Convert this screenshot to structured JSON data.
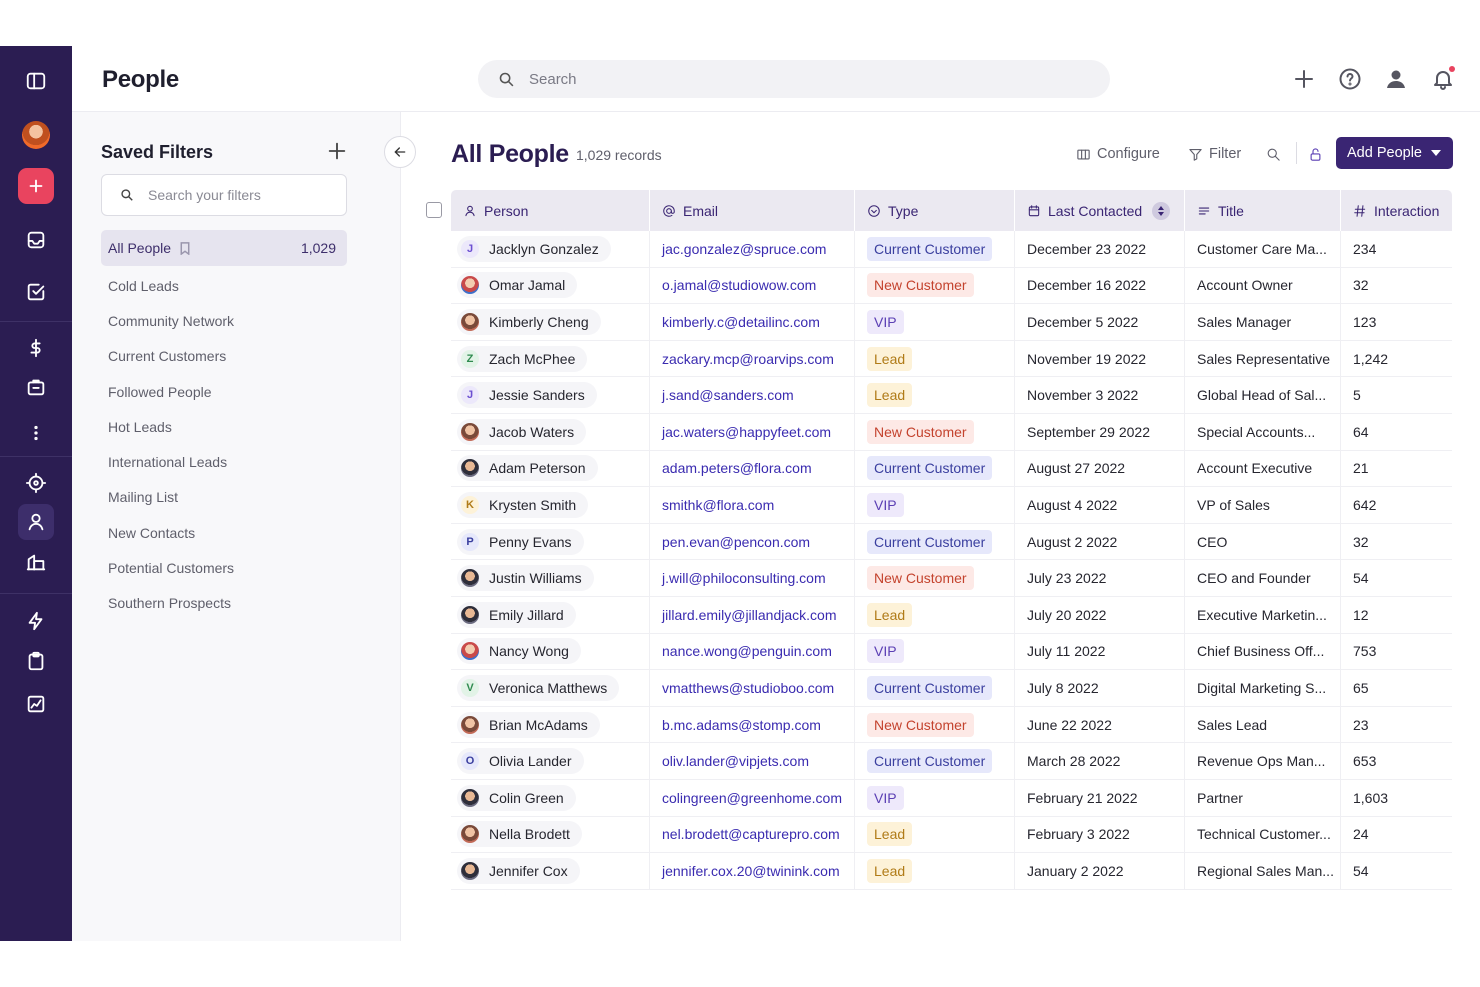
{
  "header": {
    "page_title": "People",
    "search_placeholder": "Search"
  },
  "rail": {
    "icons": [
      "sidebar-toggle-icon",
      "avatar",
      "add-icon",
      "inbox-icon",
      "tasks-icon",
      "dollar-icon",
      "briefcase-icon",
      "more-icon",
      "target-icon",
      "person-icon",
      "building-icon",
      "lightning-icon",
      "clipboard-icon",
      "chart-icon"
    ],
    "accent": "#e9445f",
    "bg": "#2b1d52"
  },
  "filters": {
    "title": "Saved Filters",
    "search_placeholder": "Search your filters",
    "items": [
      {
        "label": "All People",
        "count": "1,029"
      },
      {
        "label": "Cold Leads"
      },
      {
        "label": "Community Network"
      },
      {
        "label": "Current Customers"
      },
      {
        "label": "Followed People"
      },
      {
        "label": "Hot Leads"
      },
      {
        "label": "International Leads"
      },
      {
        "label": "Mailing List"
      },
      {
        "label": "New Contacts"
      },
      {
        "label": "Potential Customers"
      },
      {
        "label": "Southern Prospects"
      }
    ]
  },
  "main": {
    "title": "All People",
    "record_count": "1,029 records",
    "toolbar": {
      "configure": "Configure",
      "filter": "Filter",
      "add_people": "Add People"
    },
    "columns": [
      "Person",
      "Email",
      "Type",
      "Last Contacted",
      "Title",
      "Interaction"
    ],
    "rows": [
      {
        "initial": "J",
        "avatar_color": "#6b4fd1",
        "avatar_bg": "#ece8fb",
        "name": "Jacklyn Gonzalez",
        "email": "jac.gonzalez@spruce.com",
        "type": "Current Customer",
        "date": "December 23 2022",
        "title": "Customer Care Ma...",
        "interaction": "234"
      },
      {
        "initial": "",
        "avatar_style": "photo3",
        "name": "Omar Jamal",
        "email": "o.jamal@studiowow.com",
        "type": "New Customer",
        "date": "December 16 2022",
        "title": "Account Owner",
        "interaction": "32"
      },
      {
        "initial": "",
        "avatar_style": "photo",
        "name": "Kimberly Cheng",
        "email": "kimberly.c@detailinc.com",
        "type": "VIP",
        "date": "December 5 2022",
        "title": "Sales Manager",
        "interaction": "123"
      },
      {
        "initial": "Z",
        "avatar_color": "#2f8a4f",
        "avatar_bg": "#e2f3e7",
        "name": "Zach McPhee",
        "email": "zackary.mcp@roarvips.com",
        "type": "Lead",
        "date": "November 19 2022",
        "title": "Sales Representative",
        "interaction": "1,242"
      },
      {
        "initial": "J",
        "avatar_color": "#6b4fd1",
        "avatar_bg": "#ece8fb",
        "name": "Jessie Sanders",
        "email": "j.sand@sanders.com",
        "type": "Lead",
        "date": "November 3 2022",
        "title": "Global Head of Sal...",
        "interaction": "5"
      },
      {
        "initial": "",
        "avatar_style": "photo",
        "name": "Jacob Waters",
        "email": "jac.waters@happyfeet.com",
        "type": "New Customer",
        "date": "September 29 2022",
        "title": "Special Accounts...",
        "interaction": "64"
      },
      {
        "initial": "",
        "avatar_style": "photo2",
        "name": "Adam Peterson",
        "email": "adam.peters@flora.com",
        "type": "Current Customer",
        "date": "August 27 2022",
        "title": "Account Executive",
        "interaction": "21"
      },
      {
        "initial": "K",
        "avatar_color": "#b07b17",
        "avatar_bg": "#fdf2d8",
        "name": "Krysten Smith",
        "email": "smithk@flora.com",
        "type": "VIP",
        "date": "August 4 2022",
        "title": "VP of Sales",
        "interaction": "642"
      },
      {
        "initial": "P",
        "avatar_color": "#3a3f9f",
        "avatar_bg": "#e6e8fb",
        "name": "Penny Evans",
        "email": "pen.evan@pencon.com",
        "type": "Current Customer",
        "date": "August 2 2022",
        "title": "CEO",
        "interaction": "32"
      },
      {
        "initial": "",
        "avatar_style": "photo2",
        "name": "Justin Williams",
        "email": "j.will@philoconsulting.com",
        "type": "New Customer",
        "date": "July 23 2022",
        "title": "CEO and Founder",
        "interaction": "54"
      },
      {
        "initial": "",
        "avatar_style": "photo2",
        "name": "Emily Jillard",
        "email": "jillard.emily@jillandjack.com",
        "type": "Lead",
        "date": "July 20 2022",
        "title": "Executive Marketin...",
        "interaction": "12"
      },
      {
        "initial": "",
        "avatar_style": "photo3",
        "name": "Nancy Wong",
        "email": "nance.wong@penguin.com",
        "type": "VIP",
        "date": "July 11 2022",
        "title": "Chief Business Off...",
        "interaction": "753"
      },
      {
        "initial": "V",
        "avatar_color": "#2f8a4f",
        "avatar_bg": "#e2f3e7",
        "name": "Veronica Matthews",
        "email": "vmatthews@studioboo.com",
        "type": "Current Customer",
        "date": "July 8 2022",
        "title": "Digital Marketing S...",
        "interaction": "65"
      },
      {
        "initial": "",
        "avatar_style": "photo",
        "name": "Brian McAdams",
        "email": "b.mc.adams@stomp.com",
        "type": "New Customer",
        "date": "June 22 2022",
        "title": "Sales Lead",
        "interaction": "23"
      },
      {
        "initial": "O",
        "avatar_color": "#3a3f9f",
        "avatar_bg": "#e6e8fb",
        "name": "Olivia Lander",
        "email": "oliv.lander@vipjets.com",
        "type": "Current Customer",
        "date": "March 28 2022",
        "title": "Revenue Ops Man...",
        "interaction": "653"
      },
      {
        "initial": "",
        "avatar_style": "photo2",
        "name": "Colin Green",
        "email": "colingreen@greenhome.com",
        "type": "VIP",
        "date": "February 21 2022",
        "title": "Partner",
        "interaction": "1,603"
      },
      {
        "initial": "",
        "avatar_style": "photo",
        "name": "Nella Brodett",
        "email": "nel.brodett@capturepro.com",
        "type": "Lead",
        "date": "February 3 2022",
        "title": "Technical Customer...",
        "interaction": "24"
      },
      {
        "initial": "",
        "avatar_style": "photo2",
        "name": "Jennifer Cox",
        "email": "jennifer.cox.20@twinink.com",
        "type": "Lead",
        "date": "January 2 2022",
        "title": "Regional Sales Man...",
        "interaction": "54"
      }
    ],
    "type_colors": {
      "Current Customer": "#e6e8fb",
      "New Customer": "#fde9e6",
      "VIP": "#eee9fb",
      "Lead": "#fdf2d8"
    }
  }
}
